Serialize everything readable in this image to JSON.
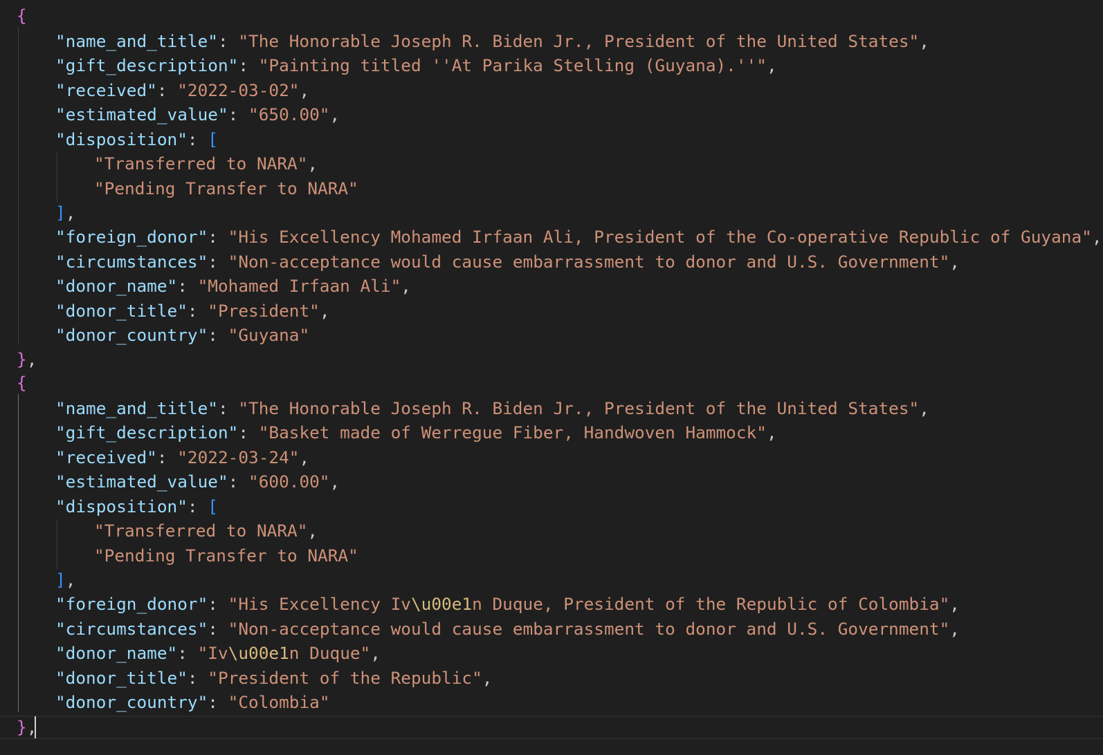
{
  "entries": [
    {
      "fields": [
        {
          "key": "\"name_and_title\"",
          "value": "\"The Honorable Joseph R. Biden Jr., President of the United States\""
        },
        {
          "key": "\"gift_description\"",
          "value": "\"Painting titled ''At Parika Stelling (Guyana).''\""
        },
        {
          "key": "\"received\"",
          "value": "\"2022-03-02\""
        },
        {
          "key": "\"estimated_value\"",
          "value": "\"650.00\""
        },
        {
          "key": "\"disposition\"",
          "items": [
            "\"Transferred to NARA\"",
            "\"Pending Transfer to NARA\""
          ]
        },
        {
          "key": "\"foreign_donor\"",
          "value": "\"His Excellency Mohamed Irfaan Ali, President of the Co-operative Republic of Guyana\""
        },
        {
          "key": "\"circumstances\"",
          "value": "\"Non-acceptance would cause embarrassment to donor and U.S. Government\""
        },
        {
          "key": "\"donor_name\"",
          "value": "\"Mohamed Irfaan Ali\""
        },
        {
          "key": "\"donor_title\"",
          "value": "\"President\""
        },
        {
          "key": "\"donor_country\"",
          "value": "\"Guyana\""
        }
      ]
    },
    {
      "fields": [
        {
          "key": "\"name_and_title\"",
          "value": "\"The Honorable Joseph R. Biden Jr., President of the United States\""
        },
        {
          "key": "\"gift_description\"",
          "value": "\"Basket made of Werregue Fiber, Handwoven Hammock\""
        },
        {
          "key": "\"received\"",
          "value": "\"2022-03-24\""
        },
        {
          "key": "\"estimated_value\"",
          "value": "\"600.00\""
        },
        {
          "key": "\"disposition\"",
          "items": [
            "\"Transferred to NARA\"",
            "\"Pending Transfer to NARA\""
          ]
        },
        {
          "key": "\"foreign_donor\"",
          "value_pre": "\"His Excellency Iv",
          "value_esc": "\\u00e1",
          "value_post": "n Duque, President of the Republic of Colombia\""
        },
        {
          "key": "\"circumstances\"",
          "value": "\"Non-acceptance would cause embarrassment to donor and U.S. Government\""
        },
        {
          "key": "\"donor_name\"",
          "value_pre": "\"Iv",
          "value_esc": "\\u00e1",
          "value_post": "n Duque\""
        },
        {
          "key": "\"donor_title\"",
          "value": "\"President of the Republic\""
        },
        {
          "key": "\"donor_country\"",
          "value": "\"Colombia\""
        }
      ]
    }
  ],
  "punct": {
    "open_brace": "{",
    "close_brace": "}",
    "open_bracket": "[",
    "close_bracket": "]",
    "comma": ",",
    "colon": ": "
  },
  "colors": {
    "background": "#1f1f1f",
    "key": "#9cdcfe",
    "string": "#ce9178",
    "escape": "#d7ba7d",
    "brace": "#da70d6",
    "bracket": "#3794ff"
  }
}
